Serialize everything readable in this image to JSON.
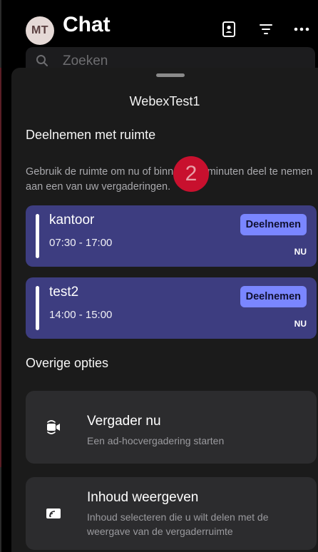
{
  "header": {
    "avatar_initials": "MT",
    "title": "Chat",
    "icons": [
      "contacts-icon",
      "filter-icon",
      "more-icon"
    ]
  },
  "search": {
    "placeholder": "Zoeken"
  },
  "sheet": {
    "title": "WebexTest1",
    "join_section": {
      "title": "Deelnemen met ruimte",
      "description": "Gebruik de ruimte om nu of binnen tien minuten deel te nemen aan een van uw vergaderingen.",
      "meetings": [
        {
          "name": "kantoor",
          "time": "07:30 - 17:00",
          "join_label": "Deelnemen",
          "status": "NU"
        },
        {
          "name": "test2",
          "time": "14:00 - 15:00",
          "join_label": "Deelnemen",
          "status": "NU"
        }
      ]
    },
    "step_badge": "2",
    "other_section": {
      "title": "Overige opties",
      "options": [
        {
          "icon": "meet-now-icon",
          "title": "Vergader nu",
          "subtitle": "Een ad-hocvergadering starten"
        },
        {
          "icon": "share-screen-icon",
          "title": "Inhoud weergeven",
          "subtitle": "Inhoud selecteren die u wilt delen met de weergave van de vergaderruimte"
        }
      ]
    }
  },
  "colors": {
    "background": "#000000",
    "sheet": "#1b1b1b",
    "meeting_card": "#3d3d80",
    "join_button": "#7a86ff",
    "option_card": "#2c2c2e",
    "badge": "#c8102e"
  }
}
